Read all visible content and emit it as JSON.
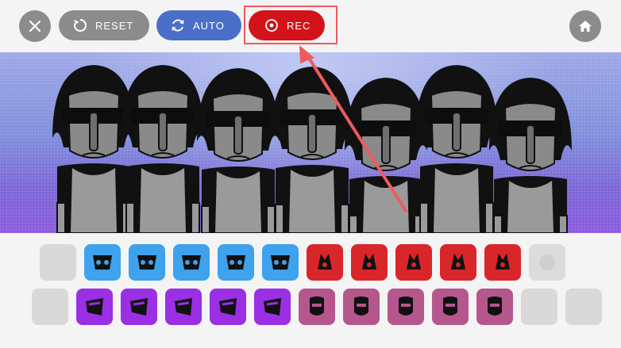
{
  "toolbar": {
    "reset_label": "RESET",
    "auto_label": "AUTO",
    "rec_label": "REC"
  },
  "colors": {
    "reset": "#8c8c8c",
    "auto": "#4a6fc9",
    "rec": "#d4121a",
    "highlight": "#ef5a5f",
    "beats": "#3ea2ec",
    "effects": "#d9262b",
    "melodies": "#9a2fe3",
    "voices": "#b5578c"
  },
  "icons": {
    "close": "close-icon",
    "reset": "reset-icon",
    "auto": "auto-icon",
    "rec": "record-icon",
    "home": "home-icon"
  },
  "stage": {
    "performer_count": 7
  },
  "sound_rows": [
    {
      "slots": [
        "empty",
        "beats",
        "beats",
        "beats",
        "beats",
        "beats",
        "effects",
        "effects",
        "effects",
        "effects",
        "effects",
        "ghost"
      ]
    },
    {
      "slots": [
        "empty",
        "melodies",
        "melodies",
        "melodies",
        "melodies",
        "melodies",
        "voices",
        "voices",
        "voices",
        "voices",
        "voices",
        "empty",
        "empty"
      ]
    }
  ]
}
